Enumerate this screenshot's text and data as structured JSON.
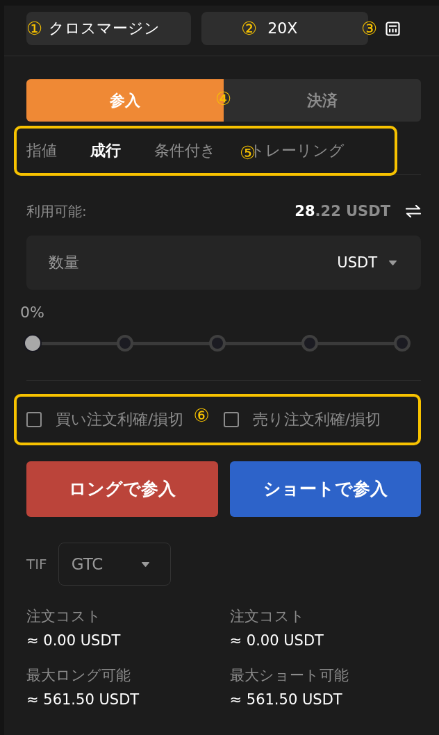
{
  "header": {
    "margin_mode": {
      "marker": "①",
      "label": "クロスマージン"
    },
    "leverage": {
      "marker": "②",
      "label": "20X"
    },
    "calculator_marker": "③"
  },
  "side_tabs": {
    "marker": "④",
    "tabs": [
      {
        "label": "参入",
        "selected": true
      },
      {
        "label": "決済",
        "selected": false
      }
    ]
  },
  "order_types": {
    "marker": "⑤",
    "tabs": [
      {
        "label": "指値",
        "selected": false
      },
      {
        "label": "成行",
        "selected": true
      },
      {
        "label": "条件付き",
        "selected": false
      },
      {
        "label": "トレーリング",
        "selected": false
      }
    ]
  },
  "available": {
    "label": "利用可能:",
    "value_main": "28",
    "value_rest": ".22 USDT"
  },
  "quantity": {
    "placeholder": "数量",
    "unit": "USDT"
  },
  "slider": {
    "reading": "0%",
    "level": 0
  },
  "tpsl": {
    "marker": "⑥",
    "options": [
      {
        "label": "買い注文利確/損切",
        "checked": false
      },
      {
        "label": "売り注文利確/損切",
        "checked": false
      }
    ]
  },
  "actions": [
    {
      "label": "ロングで参入",
      "kind": "long"
    },
    {
      "label": "ショートで参入",
      "kind": "short"
    }
  ],
  "tif": {
    "label": "TIF",
    "value": "GTC"
  },
  "stats": [
    {
      "label": "注文コスト",
      "value": "≈ 0.00 USDT"
    },
    {
      "label": "注文コスト",
      "value": "≈ 0.00 USDT"
    },
    {
      "label": "最大ロング可能",
      "value": "≈ 561.50 USDT"
    },
    {
      "label": "最大ショート可能",
      "value": "≈ 561.50 USDT"
    }
  ]
}
